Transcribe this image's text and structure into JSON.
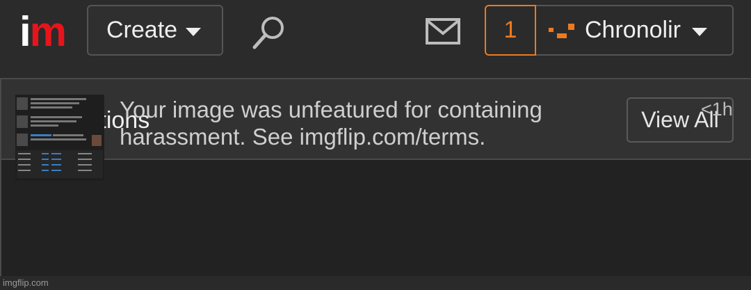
{
  "header": {
    "logo_i": "i",
    "logo_m": "m",
    "create_label": "Create",
    "notification_count": "1",
    "username": "Chronolir",
    "icons": {
      "search": "search-icon",
      "mail": "mail-icon",
      "caret": "caret-down-icon"
    },
    "colors": {
      "accent": "#ee7a1f",
      "logo_red": "#e8141b"
    }
  },
  "notifications": {
    "title": "Notifications",
    "view_all_label": "View All",
    "items": [
      {
        "text": "Your image was unfeatured for containing harassment. See imgflip.com/terms.",
        "time": "<1h"
      }
    ]
  },
  "footer": {
    "watermark": "imgflip.com"
  }
}
